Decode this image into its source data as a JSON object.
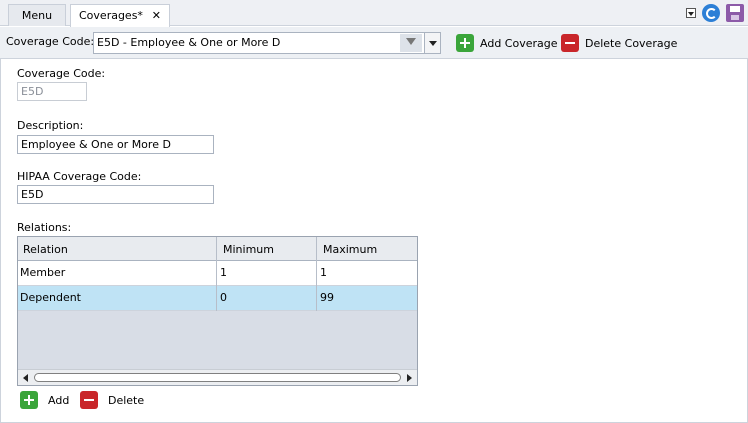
{
  "tabs": [
    {
      "label": "Menu"
    },
    {
      "label": "Coverages*",
      "close": "✕"
    }
  ],
  "toolbar": {
    "coverage_code_label": "Coverage Code:",
    "coverage_code_value": "E5D - Employee & One or More D",
    "add_label": "Add Coverage",
    "delete_label": "Delete Coverage"
  },
  "form": {
    "coverage_code_label": "Coverage Code:",
    "coverage_code_value": "E5D",
    "description_label": "Description:",
    "description_value": "Employee & One or More D",
    "hipaa_label": "HIPAA Coverage Code:",
    "hipaa_value": "E5D",
    "relations_label": "Relations:"
  },
  "relations": {
    "columns": [
      "Relation",
      "Minimum",
      "Maximum"
    ],
    "rows": [
      {
        "relation": "Member",
        "minimum": "1",
        "maximum": "1",
        "selected": false
      },
      {
        "relation": "Dependent",
        "minimum": "0",
        "maximum": "99",
        "selected": true
      }
    ],
    "add_label": "Add",
    "delete_label": "Delete"
  },
  "colors": {
    "selected_row": "#bfe3f5",
    "add_green": "#3aa53a",
    "delete_red": "#c9262a"
  },
  "icons": [
    "dropdown-icon",
    "refresh-icon",
    "save-icon",
    "filter-icon",
    "add-icon",
    "delete-icon"
  ]
}
